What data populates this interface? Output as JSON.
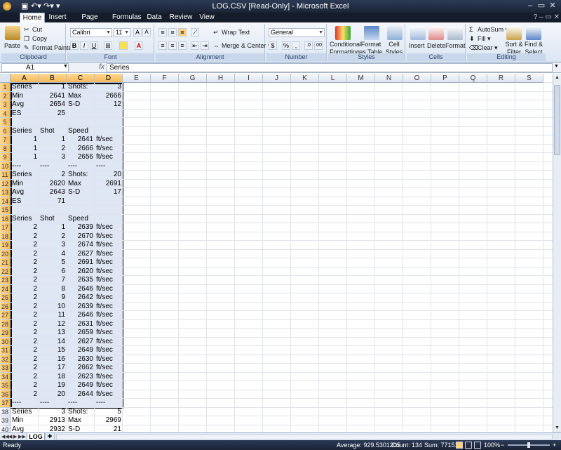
{
  "titlebar": {
    "office_icon": "office-orb",
    "title": "LOG.CSV  [Read-Only] - Microsoft Excel",
    "quick_access": [
      "save-icon",
      "undo-icon",
      "redo-icon",
      "customize-icon"
    ],
    "window_buttons": {
      "minimize": "–",
      "maximize": "▭",
      "close": "✕"
    }
  },
  "tabs": [
    {
      "label": "Home",
      "active": true
    },
    {
      "label": "Insert"
    },
    {
      "label": "Page Layout"
    },
    {
      "label": "Formulas"
    },
    {
      "label": "Data"
    },
    {
      "label": "Review"
    },
    {
      "label": "View"
    }
  ],
  "ribbon": {
    "clipboard": {
      "paste": "Paste",
      "cut": "Cut",
      "copy": "Copy",
      "format_painter": "Format Painter",
      "label": "Clipboard"
    },
    "font": {
      "family": "Calibri",
      "size": "11",
      "bold": "B",
      "italic": "I",
      "underline": "U",
      "label": "Font"
    },
    "alignment": {
      "wrap_text": "Wrap Text",
      "merge_center": "Merge & Center",
      "label": "Alignment"
    },
    "number": {
      "format": "General",
      "currency": "$",
      "percent": "%",
      "comma": ",",
      "label": "Number"
    },
    "styles": {
      "conditional": [
        "Conditional",
        "Formatting"
      ],
      "format_table": [
        "Format",
        "as Table"
      ],
      "cell_styles": [
        "Cell",
        "Styles"
      ],
      "label": "Styles"
    },
    "cells": {
      "insert": "Insert",
      "delete": "Delete",
      "format": "Format",
      "label": "Cells"
    },
    "editing": {
      "autosum": "AutoSum",
      "fill": "Fill",
      "clear": "Clear",
      "sort": [
        "Sort &",
        "Filter"
      ],
      "find": [
        "Find &",
        "Select"
      ],
      "label": "Editing"
    }
  },
  "formula_bar": {
    "name_box": "A1",
    "fx": "fx",
    "content": "Series"
  },
  "columns": [
    "A",
    "B",
    "C",
    "D",
    "E",
    "F",
    "G",
    "H",
    "I",
    "J",
    "K",
    "L",
    "M",
    "N",
    "O",
    "P",
    "Q",
    "R",
    "S"
  ],
  "rows": [
    [
      "Series",
      "1",
      "Shots:",
      "3"
    ],
    [
      "Min",
      "2641",
      "Max",
      "2666"
    ],
    [
      "Avg",
      "2654",
      "S-D",
      "12"
    ],
    [
      "ES",
      "25",
      "",
      ""
    ],
    [
      "",
      "",
      "",
      ""
    ],
    [
      "Series",
      "Shot",
      "Speed",
      ""
    ],
    [
      "1",
      "1",
      "2641",
      "ft/sec"
    ],
    [
      "1",
      "2",
      "2666",
      "ft/sec"
    ],
    [
      "1",
      "3",
      "2656",
      "ft/sec"
    ],
    [
      "----",
      "----",
      "----",
      "----"
    ],
    [
      "Series",
      "2",
      "Shots:",
      "20"
    ],
    [
      "Min",
      "2620",
      "Max",
      "2691"
    ],
    [
      "Avg",
      "2643",
      "S-D",
      "17"
    ],
    [
      "ES",
      "71",
      "",
      ""
    ],
    [
      "",
      "",
      "",
      ""
    ],
    [
      "Series",
      "Shot",
      "Speed",
      ""
    ],
    [
      "2",
      "1",
      "2639",
      "ft/sec"
    ],
    [
      "2",
      "2",
      "2670",
      "ft/sec"
    ],
    [
      "2",
      "3",
      "2674",
      "ft/sec"
    ],
    [
      "2",
      "4",
      "2627",
      "ft/sec"
    ],
    [
      "2",
      "5",
      "2691",
      "ft/sec"
    ],
    [
      "2",
      "6",
      "2620",
      "ft/sec"
    ],
    [
      "2",
      "7",
      "2635",
      "ft/sec"
    ],
    [
      "2",
      "8",
      "2646",
      "ft/sec"
    ],
    [
      "2",
      "9",
      "2642",
      "ft/sec"
    ],
    [
      "2",
      "10",
      "2639",
      "ft/sec"
    ],
    [
      "2",
      "11",
      "2646",
      "ft/sec"
    ],
    [
      "2",
      "12",
      "2631",
      "ft/sec"
    ],
    [
      "2",
      "13",
      "2659",
      "ft/sec"
    ],
    [
      "2",
      "14",
      "2627",
      "ft/sec"
    ],
    [
      "2",
      "15",
      "2649",
      "ft/sec"
    ],
    [
      "2",
      "16",
      "2630",
      "ft/sec"
    ],
    [
      "2",
      "17",
      "2662",
      "ft/sec"
    ],
    [
      "2",
      "18",
      "2623",
      "ft/sec"
    ],
    [
      "2",
      "19",
      "2649",
      "ft/sec"
    ],
    [
      "2",
      "20",
      "2644",
      "ft/sec"
    ],
    [
      "----",
      "----",
      "----",
      "----"
    ],
    [
      "Series",
      "3",
      "Shots:",
      "5"
    ],
    [
      "Min",
      "2913",
      "Max",
      "2969"
    ],
    [
      "Avg",
      "2932",
      "S-D",
      "21"
    ]
  ],
  "sheet_tabs": {
    "active": "LOG",
    "nav": [
      "◀◀",
      "◀",
      "▶",
      "▶▶"
    ]
  },
  "status": {
    "ready": "Ready",
    "average": "Average: 929.5301205",
    "count": "Count: 134",
    "sum": "Sum: 77151",
    "zoom": "100%",
    "zoom_minus": "−",
    "zoom_plus": "+"
  },
  "colors": {
    "title_bar": "#1b2436",
    "selection_fill": "#c4d2eb",
    "header_selected": "#f5b95a"
  }
}
